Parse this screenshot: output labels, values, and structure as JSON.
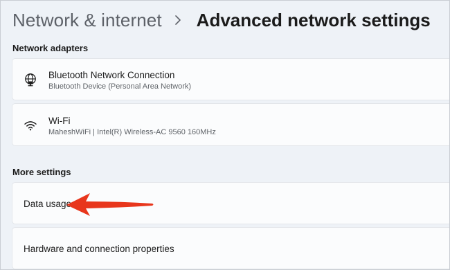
{
  "breadcrumb": {
    "parent": "Network & internet",
    "current": "Advanced network settings"
  },
  "sections": {
    "adapters_header": "Network adapters",
    "more_header": "More settings"
  },
  "adapters": [
    {
      "icon": "globe-network-icon",
      "name": "Bluetooth Network Connection",
      "description": "Bluetooth Device (Personal Area Network)"
    },
    {
      "icon": "wifi-icon",
      "name": "Wi-Fi",
      "description": "MaheshWiFi | Intel(R) Wireless-AC 9560 160MHz"
    }
  ],
  "more_settings": [
    {
      "label": "Data usage"
    },
    {
      "label": "Hardware and connection properties"
    }
  ],
  "annotation": {
    "icon": "red-arrow-icon",
    "color": "#e8361c"
  },
  "colors": {
    "background": "#eef2f7",
    "card": "#fbfcfd",
    "breadcrumb_parent": "#5d6168"
  }
}
